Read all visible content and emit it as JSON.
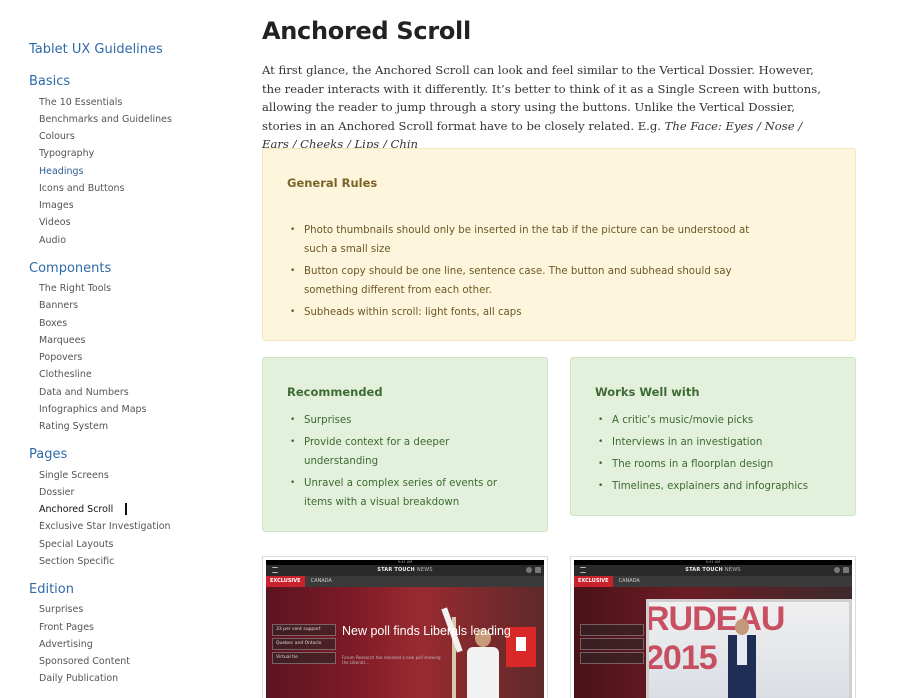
{
  "sidebar": {
    "title": "Tablet UX Guidelines",
    "sections": [
      {
        "label": "Basics",
        "items": [
          "The 10 Essentials",
          "Benchmarks and Guidelines",
          "Colours",
          "Typography",
          "Headings",
          "Icons and Buttons",
          "Images",
          "Videos",
          "Audio"
        ]
      },
      {
        "label": "Components",
        "items": [
          "The Right Tools",
          "Banners",
          "Boxes",
          "Marquees",
          "Popovers",
          "Clothesline",
          "Data and Numbers",
          "Infographics and Maps",
          "Rating System"
        ]
      },
      {
        "label": "Pages",
        "items": [
          "Single Screens",
          "Dossier",
          "Anchored Scroll",
          "Exclusive Star Investigation",
          "Special Layouts",
          "Section Specific"
        ]
      },
      {
        "label": "Edition",
        "items": [
          "Surprises",
          "Front Pages",
          "Advertising",
          "Sponsored Content",
          "Daily Publication"
        ]
      }
    ],
    "highlighted_item": "Headings",
    "current_item": "Anchored Scroll"
  },
  "main": {
    "title": "Anchored Scroll",
    "intro": "At first glance, the Anchored Scroll can look and feel similar to the Vertical Dossier. However, the reader interacts with it differently. It’s better to think of it as a Single Screen with buttons, allowing the reader to jump through a story using the buttons. Unlike the Vertical Dossier, stories in an Anchored Scroll format have to be closely related. E.g. ",
    "intro_example": "The Face: Eyes / Nose / Ears / Cheeks / Lips / Chin",
    "general_rules": {
      "title": "General Rules",
      "items": [
        "Photo thumbnails should only be inserted in the tab if the picture can be understood at such a small size",
        "Button copy should be one line, sentence case. The button and subhead should say something different from each other.",
        "Subheads within scroll: light fonts, all caps"
      ]
    },
    "recommended": {
      "title": "Recommended",
      "items": [
        "Surprises",
        "Provide context for a deeper understanding",
        "Unravel a complex series of events or items with a visual breakdown"
      ]
    },
    "works_well": {
      "title": "Works Well with",
      "items": [
        "A critic’s music/movie picks",
        "Interviews in an investigation",
        "The rooms in a floorplan design",
        "Timelines, explainers and infographics"
      ]
    },
    "thumbnails": [
      {
        "status_time": "9:41 AM",
        "app_title": "STAR TOUCH",
        "app_title_suffix": "NEWS",
        "tab_exclusive": "EXCLUSIVE",
        "tab_canada": "CANADA",
        "chips": [
          "33 per cent support",
          "Quebec and Ontario",
          "Virtual tie"
        ],
        "headline": "New poll finds Liberals leading",
        "subtext": "Forum Research has released a new poll showing the Liberals..."
      },
      {
        "status_time": "9:41 AM",
        "app_title": "STAR TOUCH",
        "app_title_suffix": "NEWS",
        "tab_exclusive": "EXCLUSIVE",
        "tab_canada": "CANADA",
        "chips": [
          "",
          "",
          ""
        ],
        "poster_text": "RUDEAU 2015"
      }
    ]
  },
  "colors": {
    "link_blue": "#2f6aa8",
    "rules_bg": "#fdf6dc",
    "green_bg": "#e3f1dc",
    "exclusive_red": "#c8232c"
  }
}
